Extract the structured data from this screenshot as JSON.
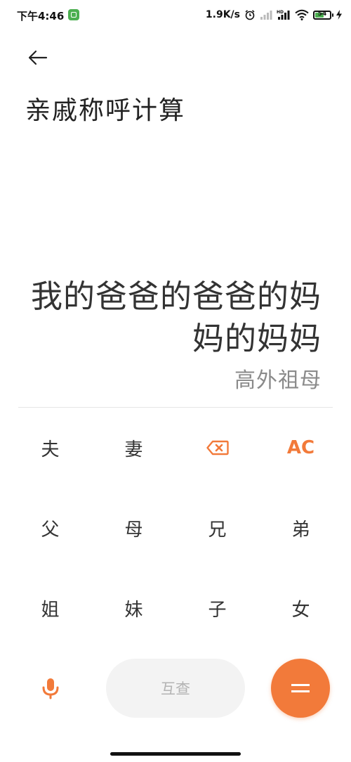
{
  "status_bar": {
    "time": "下午4:46",
    "net_speed": "1.9K/s",
    "battery_level": "54",
    "battery_fraction": 0.54,
    "icons": [
      "app-notification-icon",
      "alarm-icon",
      "signal-icon",
      "hd-signal-icon",
      "wifi-icon",
      "battery-icon",
      "charging-icon"
    ]
  },
  "header": {
    "back_icon": "arrow-left-icon",
    "title": "亲戚称呼计算"
  },
  "display": {
    "expression": "我的爸爸的爸爸的妈妈的妈妈",
    "result": "高外祖母"
  },
  "keypad": {
    "keys": [
      "夫",
      "妻",
      "",
      "AC",
      "父",
      "母",
      "兄",
      "弟",
      "姐",
      "妹",
      "子",
      "女"
    ],
    "backspace_icon": "backspace-icon"
  },
  "bottom": {
    "mic_icon": "microphone-icon",
    "lookup_label": "互查",
    "equals_icon": "equals-icon"
  },
  "colors": {
    "accent": "#f27a3a",
    "status_green": "#4caf50"
  }
}
